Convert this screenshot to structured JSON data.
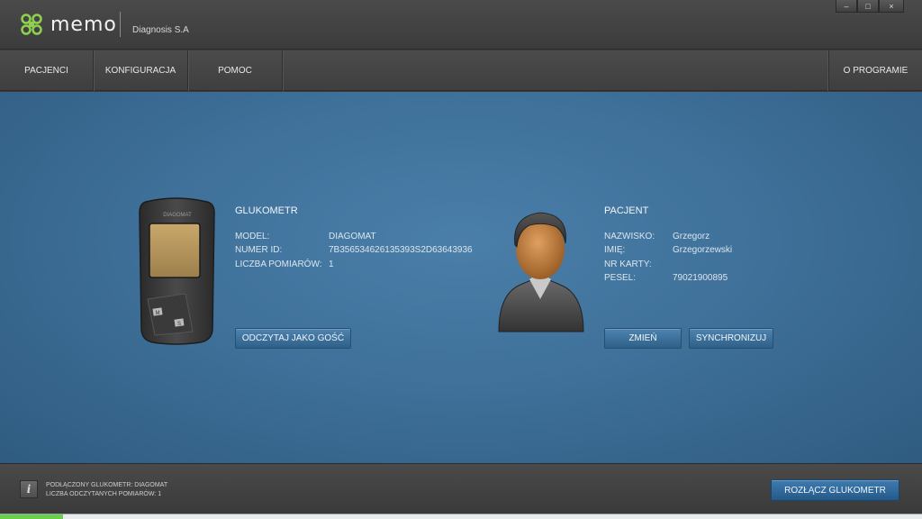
{
  "header": {
    "logo_text": "memo",
    "company": "Diagnosis S.A",
    "window_controls": {
      "minimize": "–",
      "maximize": "□",
      "close": "×"
    }
  },
  "nav": {
    "items": [
      "PACJENCI",
      "KONFIGURACJA",
      "POMOC"
    ],
    "right_item": "O PROGRAMIE"
  },
  "glucometer": {
    "title": "GLUKOMETR",
    "device_brand": "DIAGOMAT",
    "device_keys": [
      "M",
      "S"
    ],
    "fields": [
      {
        "label": "MODEL:",
        "value": "DIAGOMAT"
      },
      {
        "label": "NUMER ID:",
        "value": "7B356534626135393S2D63643936"
      },
      {
        "label": "LICZBA POMIARÓW:",
        "value": "1"
      }
    ],
    "button_read_guest": "ODCZYTAJ JAKO GOŚĆ"
  },
  "patient": {
    "title": "PACJENT",
    "fields": [
      {
        "label": "NAZWISKO:",
        "value": "Grzegorz"
      },
      {
        "label": "IMIĘ:",
        "value": "Grzegorzewski"
      },
      {
        "label": "NR KARTY:",
        "value": ""
      },
      {
        "label": "PESEL:",
        "value": "79021900895"
      }
    ],
    "button_change": "ZMIEŃ",
    "button_sync": "SYNCHRONIZUJ"
  },
  "footer": {
    "info_icon": "i",
    "status_connected": "PODŁĄCZONY GLUKOMETR: DIAGOMAT",
    "status_count": "LICZBA ODCZYTANYCH POMIARÓW: 1",
    "disconnect_button": "ROZŁĄCZ GLUKOMETR"
  },
  "colors": {
    "accent": "#3f7bb0",
    "main_bg": "#3f719a",
    "logo_green": "#8fd14f"
  }
}
